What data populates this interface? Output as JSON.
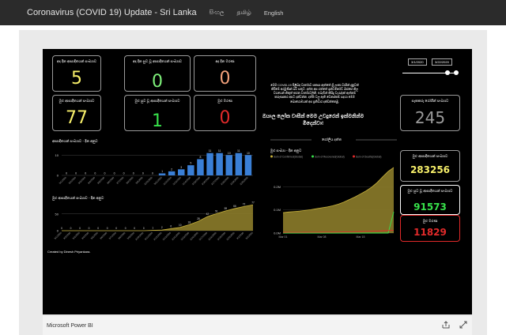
{
  "navbar": {
    "title": "Coronavirus (COVID 19) Update - Sri Lanka",
    "links": [
      "සිංහල",
      "தமிழ்",
      "English"
    ]
  },
  "report": {
    "cards": [
      {
        "title": "අද දින ආසාදිතයන් සංඛ්‍යාව",
        "value": "5",
        "color": "#f7ef6a"
      },
      {
        "title": "අද දින සුව වූ ආසාදිතයන් සංඛ්‍යාව",
        "value": "0",
        "color": "#7ef07a"
      },
      {
        "title": "අද දින මරණ",
        "value": "0",
        "color": "#f2a07a"
      },
      {
        "title": "මුළු ආසාදිතයන් සංඛ්‍යාව",
        "value": "77",
        "color": "#f7ef6a"
      },
      {
        "title": "මුළු සුව වූ ආසාදිතයන් සංඛ්‍යාව",
        "value": "1",
        "color": "#37e14a"
      },
      {
        "title": "මුළු මරණ",
        "value": "0",
        "color": "#e12a2a"
      }
    ],
    "info_text": "මෙම COVID-19 පිළිබඳ වාර්තාව සකසා ඇත්තේ ශ්‍රී ලංකා වාසීන් දැනුවත් කිරීමේ අරමුණින් බව සතුට. දත්ත අප ගත්තේ ඉන්ටර්නෙට් ඔස්සේ නිල වශයෙන් නිකුත් කරන වාර්තාවලිනි. එබැවින් කිසිදු වැරැද්දක් ඇත්නම් කරුණාකර අපට දන්වන්න. දත්ත වල ඇති වෙනස්කම් සදහා මෙම බොහොමයක් අප ප්‍රතිචාර දක්වන්නෙමු.",
    "headline": "ඔයාල ලෝක වාසීන් මෙම උවදුරෙන් ඉක්මනින්ම මිදෙන්වා!",
    "suspected": {
      "title": "සැකකරු රෝගීන් සංඛ්‍යාව",
      "value": "245",
      "color": "#9a9a9a"
    },
    "date_start": "3/1/2020",
    "date_end": "3/22/2020",
    "global_label": "ගෝලීය දත්ත",
    "global_cards": [
      {
        "title": "මුළු ආසාදිතයන් සංඛ්‍යාව",
        "value": "283256",
        "color": "#f7ef6a",
        "border": "#9a9a9a"
      },
      {
        "title": "මුළු සුව වූ ආසාදිතයන් සංඛ්‍යාව",
        "value": "91573",
        "color": "#37e14a",
        "border": "#ffffff"
      },
      {
        "title": "මුළු මරණ",
        "value": "11829",
        "color": "#e12a2a",
        "border": "#e12a2a"
      }
    ],
    "credit": "Created by Dinesh Priyankara.",
    "colors": {
      "bar": "#3a7fd6",
      "area": "#8c7c2a",
      "area_line": "#c8b23c",
      "recovered": "#37e14a",
      "deaths": "#e12a2a"
    }
  },
  "footer": {
    "brand": "Microsoft Power BI"
  },
  "chart_data": [
    {
      "type": "bar",
      "title": "ආසාදිතයන් සංඛ්‍යාව - දින අනුව",
      "yticks": [
        0,
        10
      ],
      "ylim": [
        0,
        14
      ],
      "values": [
        0,
        0,
        0,
        0,
        0,
        0,
        0,
        0,
        0,
        0,
        1,
        2,
        3,
        5,
        8,
        11,
        11,
        10,
        11,
        10
      ],
      "x_labels": [
        "3/1/2020",
        "3/2/2020",
        "3/3/2020",
        "3/4/2020",
        "3/5/2020",
        "3/6/2020",
        "3/7/2020",
        "3/8/2020",
        "3/9/2020",
        "3/10/2020",
        "3/11/2020",
        "3/12/2020",
        "3/13/2020",
        "3/14/2020",
        "3/15/2020",
        "3/16/2020",
        "3/17/2020",
        "3/18/2020",
        "3/19/2020",
        "3/20/2020"
      ]
    },
    {
      "type": "area",
      "title": "මුළු ආසාදිතයන් සංඛ්‍යාව - දින අනුව",
      "yticks": [
        0,
        50
      ],
      "ylim": [
        0,
        80
      ],
      "values": [
        0,
        0,
        0,
        0,
        0,
        0,
        0,
        0,
        0,
        0,
        1,
        2,
        6,
        10,
        18,
        28,
        42,
        51,
        59,
        66,
        72,
        77
      ],
      "data_labels": [
        "0",
        "0",
        "0",
        "0",
        "0",
        "0",
        "0",
        "0",
        "0",
        "0",
        "1",
        "2",
        "6",
        "10",
        "18",
        "28",
        "42",
        "51",
        "59",
        "66",
        "72",
        "77"
      ]
    },
    {
      "type": "area",
      "title": "මුළු සංඛ්‍යා - දින අනුව",
      "legend": [
        "Sum of Confirmed(Global)",
        "Sum of Recovered(Global)",
        "Sum of Deaths(Global)"
      ],
      "yticks": [
        "0.0M",
        "0.1M",
        "0.2M"
      ],
      "ylim": [
        0,
        300000
      ],
      "xlabels": [
        "Mar 01",
        "Mar 08",
        "Mar 15"
      ],
      "series": [
        {
          "name": "Sum of Confirmed(Global)",
          "values": [
            88000,
            91000,
            93000,
            95000,
            98000,
            101000,
            105000,
            109000,
            113000,
            118000,
            125000,
            134000,
            145000,
            156000,
            169000,
            182000,
            198000,
            218000,
            243000,
            266000,
            283256
          ]
        },
        {
          "name": "Sum of Recovered(Global)",
          "values": [
            0,
            0,
            0,
            0,
            0,
            0,
            0,
            0,
            0,
            0,
            0,
            0,
            0,
            0,
            0,
            0,
            0,
            0,
            0,
            0,
            91573
          ]
        },
        {
          "name": "Sum of Deaths(Global)",
          "values": [
            3000,
            3100,
            3200,
            3300,
            3400,
            3500,
            3600,
            3800,
            4000,
            4300,
            4600,
            5000,
            5400,
            5800,
            6400,
            7100,
            7900,
            8800,
            9800,
            10800,
            11829
          ]
        }
      ]
    }
  ]
}
